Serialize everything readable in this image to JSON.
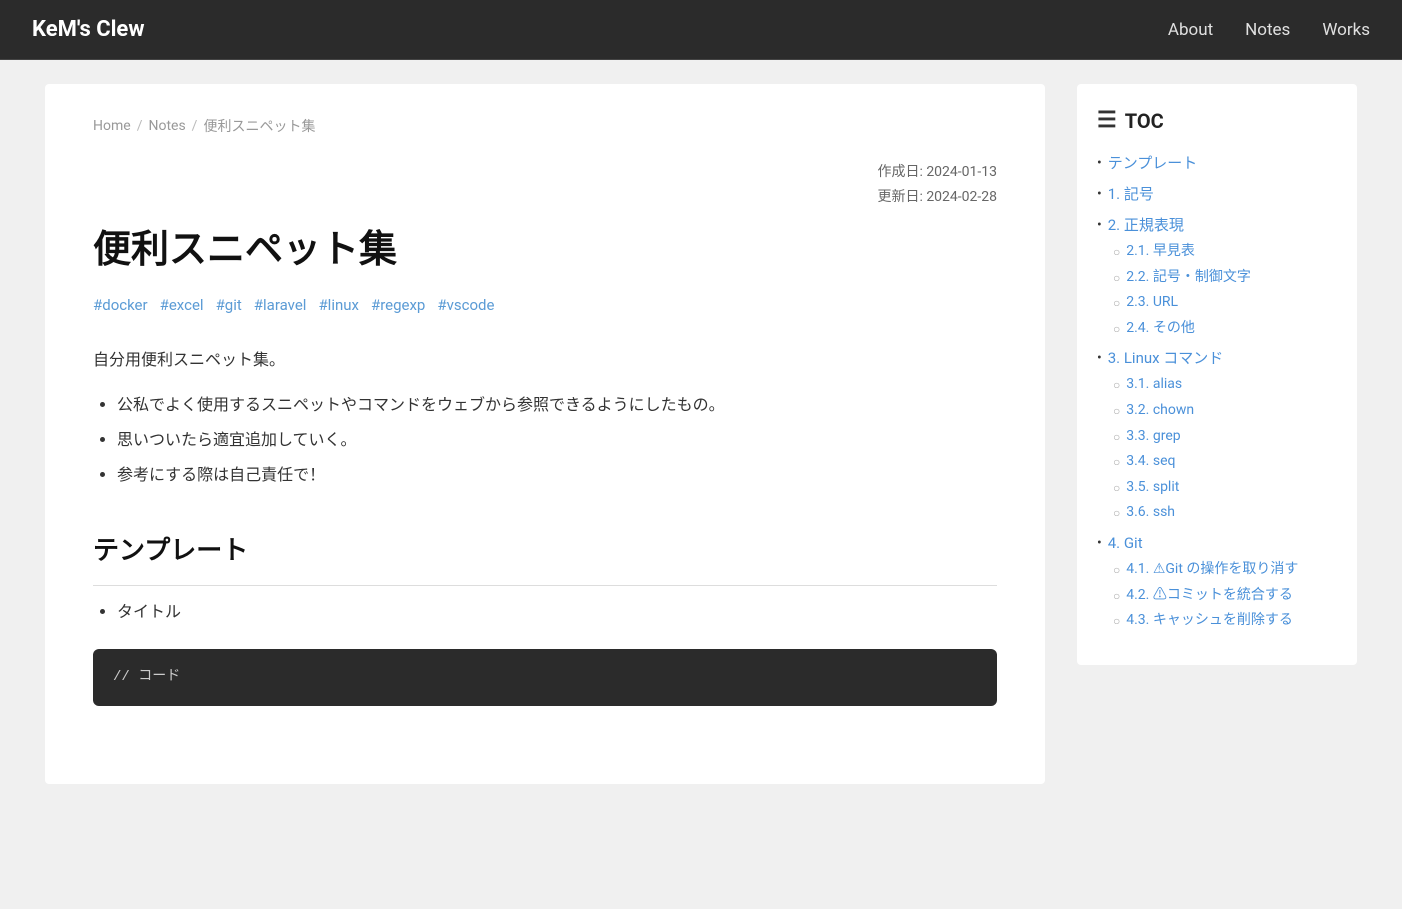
{
  "header": {
    "site_title": "KeM's Clew",
    "nav": [
      {
        "label": "About",
        "href": "#about"
      },
      {
        "label": "Notes",
        "href": "#notes"
      },
      {
        "label": "Works",
        "href": "#works"
      }
    ]
  },
  "breadcrumb": {
    "home": "Home",
    "separator1": "/",
    "notes": "Notes",
    "separator2": "/",
    "current": "便利スニペット集"
  },
  "meta": {
    "created_label": "作成日: 2024-01-13",
    "updated_label": "更新日: 2024-02-28"
  },
  "article": {
    "title": "便利スニペット集",
    "tags": [
      "#docker",
      "#excel",
      "#git",
      "#laravel",
      "#linux",
      "#regexp",
      "#vscode"
    ],
    "description": "自分用便利スニペット集。",
    "bullets": [
      "公私でよく使用するスニペットやコマンドをウェブから参照できるようにしたもの。",
      "思いついたら適宜追加していく。",
      "参考にする際は自己責任で！"
    ],
    "section1_title": "テンプレート",
    "section1_bullet1": "タイトル",
    "code_placeholder": "// コード"
  },
  "toc": {
    "header": "TOC",
    "menu_icon": "☰",
    "items": [
      {
        "label": "テンプレート",
        "sub": []
      },
      {
        "label": "1. 記号",
        "sub": []
      },
      {
        "label": "2. 正規表現",
        "sub": [
          "2.1. 早見表",
          "2.2. 記号・制御文字",
          "2.3. URL",
          "2.4. その他"
        ]
      },
      {
        "label": "3. Linux コマンド",
        "sub": [
          "3.1. alias",
          "3.2. chown",
          "3.3. grep",
          "3.4. seq",
          "3.5. split",
          "3.6. ssh"
        ]
      },
      {
        "label": "4. Git",
        "sub": [
          "4.1. ⚠Git の操作を取り消す",
          "4.2. ⚠コミットを統合する",
          "4.3. キャッシュを削除する"
        ]
      }
    ]
  }
}
